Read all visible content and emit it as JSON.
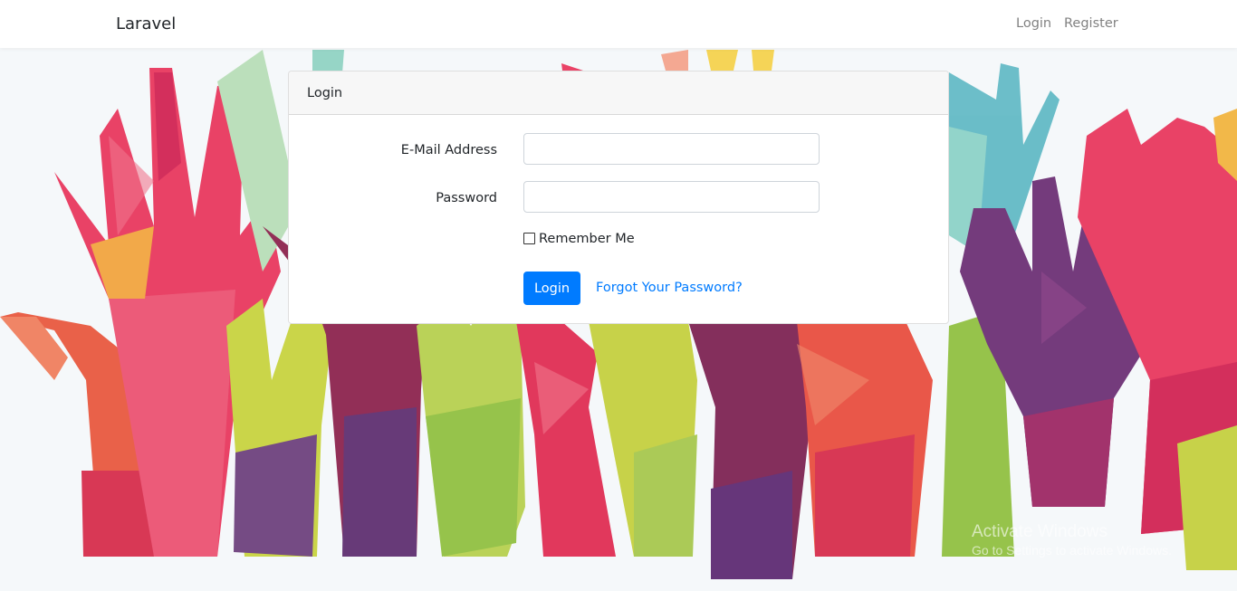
{
  "navbar": {
    "brand": "Laravel",
    "links": {
      "login": "Login",
      "register": "Register"
    }
  },
  "login_card": {
    "header": "Login",
    "email_label": "E-Mail Address",
    "email_value": "",
    "password_label": "Password",
    "password_value": "",
    "remember_label": "Remember Me",
    "remember_checked": false,
    "submit_label": "Login",
    "forgot_link": "Forgot Your Password?"
  },
  "background": {
    "icon": "raised-hands-illustration"
  },
  "watermark": {
    "title": "Activate Windows",
    "subtitle": "Go to Settings to activate Windows."
  },
  "colors": {
    "primary": "#007bff",
    "navbar_bg": "#ffffff",
    "page_bg": "#f5f8fa",
    "card_header_bg": "#f7f7f7"
  }
}
